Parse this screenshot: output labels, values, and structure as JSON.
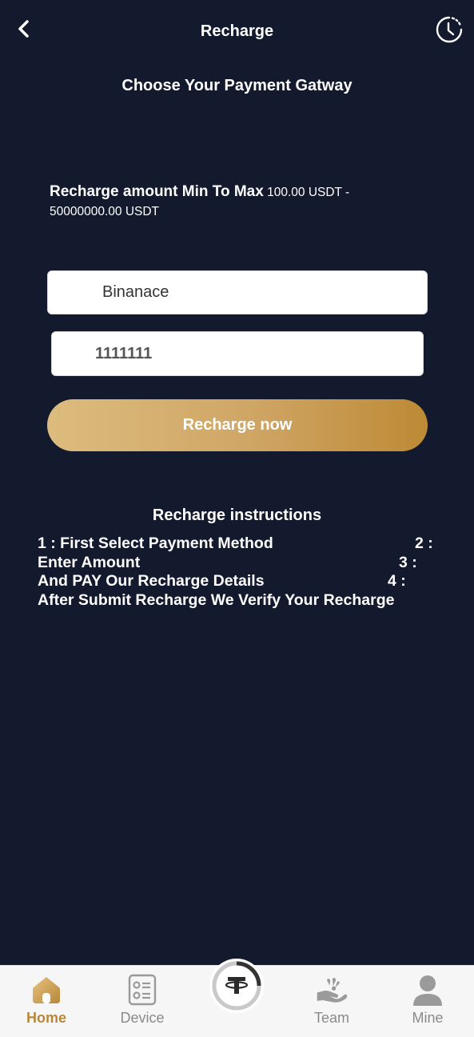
{
  "header": {
    "title": "Recharge",
    "back_icon": "chevron-left-icon",
    "history_icon": "clock-history-icon"
  },
  "subtitle": "Choose Your Payment Gatway",
  "range": {
    "label": "Recharge amount Min To Max",
    "value": "100.00 USDT - 50000000.00 USDT"
  },
  "form": {
    "method_value": "Binanace",
    "amount_value": "1111111",
    "submit_label": "Recharge now"
  },
  "instructions": {
    "title": "Recharge instructions",
    "rows": [
      {
        "text": "1 : First Select Payment Method",
        "num": "2 :"
      },
      {
        "text": "Enter Amount",
        "num": "3 :"
      },
      {
        "text": "And PAY Our Recharge Details",
        "num": "4 :"
      },
      {
        "text": "After Submit Recharge We Verify Your Recharge",
        "num": ""
      }
    ]
  },
  "tabbar": {
    "items": [
      {
        "label": "Home",
        "icon": "home-icon",
        "active": true
      },
      {
        "label": "Device",
        "icon": "device-list-icon",
        "active": false
      },
      {
        "label": "",
        "icon": "tether-coin-icon",
        "active": false
      },
      {
        "label": "Team",
        "icon": "team-hand-icon",
        "active": false
      },
      {
        "label": "Mine",
        "icon": "user-icon",
        "active": false
      }
    ]
  },
  "colors": {
    "background": "#141a2e",
    "accent": "#b7873a",
    "button_gradient_start": "#dcbc7e",
    "button_gradient_end": "#bd8a35"
  }
}
